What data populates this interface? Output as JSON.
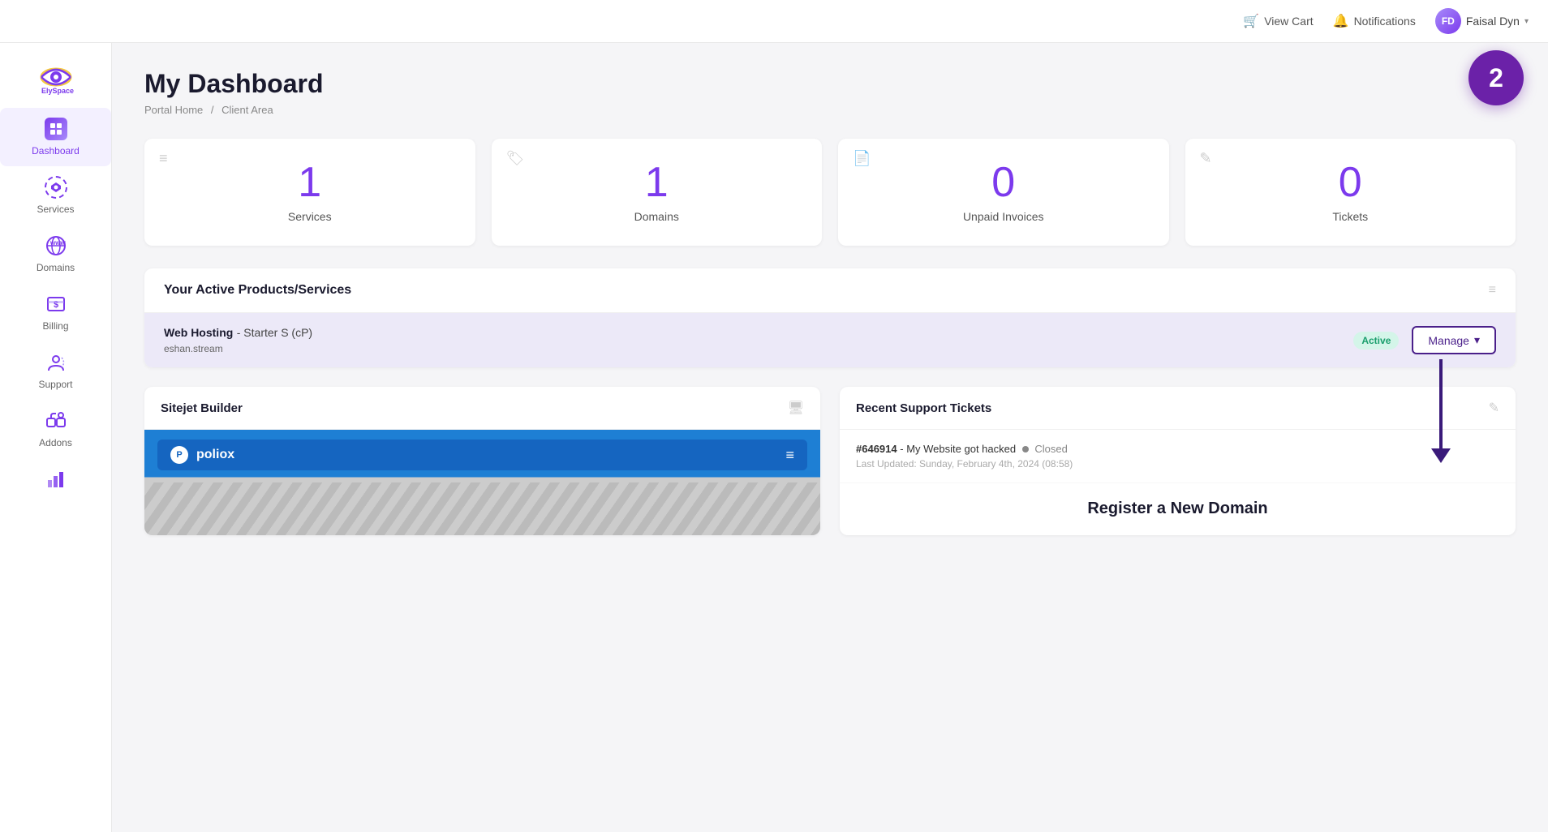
{
  "topbar": {
    "view_cart_label": "View Cart",
    "notifications_label": "Notifications",
    "user_name": "Faisal Dyn",
    "cart_icon": "🛒",
    "bell_icon": "🔔",
    "chevron": "▾"
  },
  "sidebar": {
    "logo_alt": "ElySpace",
    "items": [
      {
        "id": "dashboard",
        "label": "Dashboard",
        "icon": "⊞"
      },
      {
        "id": "services",
        "label": "Services",
        "icon": "❖"
      },
      {
        "id": "domains",
        "label": "Domains",
        "icon": "🌐"
      },
      {
        "id": "billing",
        "label": "Billing",
        "icon": "💲"
      },
      {
        "id": "support",
        "label": "Support",
        "icon": "👤"
      },
      {
        "id": "addons",
        "label": "Addons",
        "icon": "🧩"
      },
      {
        "id": "analytics",
        "label": "",
        "icon": "📊"
      }
    ]
  },
  "header": {
    "title": "My Dashboard",
    "breadcrumb_home": "Portal Home",
    "breadcrumb_sep": "/",
    "breadcrumb_current": "Client Area"
  },
  "stats": [
    {
      "value": "1",
      "label": "Services",
      "icon": "≡"
    },
    {
      "value": "1",
      "label": "Domains",
      "icon": "🏷"
    },
    {
      "value": "0",
      "label": "Unpaid Invoices",
      "icon": "📄"
    },
    {
      "value": "0",
      "label": "Tickets",
      "icon": "✎"
    }
  ],
  "active_products": {
    "section_title": "Your Active Products/Services",
    "service_name": "Web Hosting",
    "service_plan": "- Starter S (cP)",
    "service_domain": "eshan.stream",
    "status": "Active",
    "manage_label": "Manage",
    "manage_icon": "▾"
  },
  "sitejet": {
    "title": "Sitejet Builder",
    "monitor_icon": "🖥",
    "brand_letter": "P",
    "brand_name": "poliox",
    "menu_icon": "≡"
  },
  "tickets": {
    "title": "Recent Support Tickets",
    "edit_icon": "✎",
    "items": [
      {
        "id": "#646914",
        "description": "My Website got hacked",
        "status": "Closed",
        "updated": "Last Updated: Sunday, February 4th, 2024 (08:58)"
      }
    ]
  },
  "register_domain": {
    "title": "Register a New Domain"
  },
  "badge": {
    "value": "2"
  }
}
